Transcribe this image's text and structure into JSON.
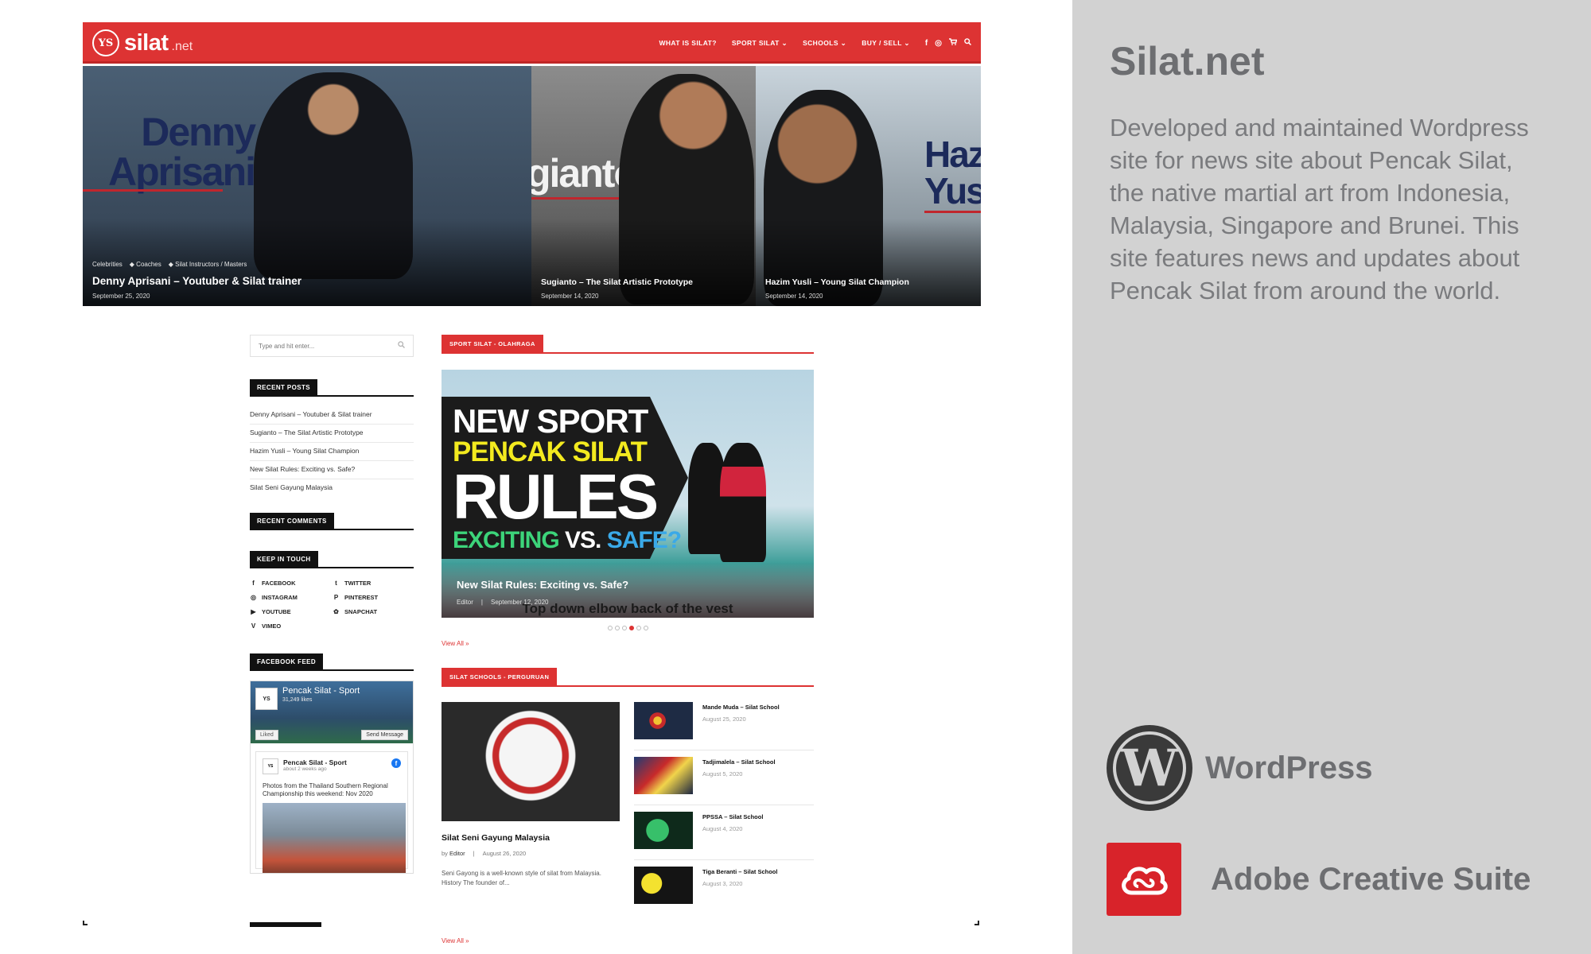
{
  "site": {
    "logo_text": "silat",
    "logo_tld": ".net",
    "logo_mark": "YS"
  },
  "nav": {
    "items": [
      "WHAT IS SILAT?",
      "SPORT SILAT ⌄",
      "SCHOOLS ⌄",
      "BUY / SELL ⌄"
    ],
    "icons": [
      "facebook-icon",
      "instagram-icon",
      "cart-icon",
      "search-icon"
    ]
  },
  "hero": {
    "slides": [
      {
        "big_name": "Denny\nAprisani",
        "categories": [
          "Celebrities",
          "◆ Coaches",
          "◆ Silat Instructors / Masters"
        ],
        "title": "Denny Aprisani – Youtuber & Silat trainer",
        "date": "September 25, 2020"
      },
      {
        "big_name": "gianto",
        "title": "Sugianto – The Silat Artistic Prototype",
        "date": "September 14, 2020"
      },
      {
        "big_name": "Hazi\nYusl",
        "title": "Hazim Yusli – Young Silat Champion",
        "date": "September 14, 2020"
      }
    ]
  },
  "sidebar": {
    "search_placeholder": "Type and hit enter...",
    "recent_posts_label": "RECENT POSTS",
    "recent_posts": [
      "Denny Aprisani – Youtuber & Silat trainer",
      "Sugianto – The Silat Artistic Prototype",
      "Hazim Yusli – Young Silat Champion",
      "New Silat Rules: Exciting vs. Safe?",
      "Silat Seni Gayung Malaysia"
    ],
    "recent_comments_label": "RECENT COMMENTS",
    "keep_in_touch_label": "KEEP IN TOUCH",
    "social": [
      {
        "glyph": "f",
        "label": "FACEBOOK",
        "icon": "facebook-icon"
      },
      {
        "glyph": "t",
        "label": "TWITTER",
        "icon": "twitter-icon"
      },
      {
        "glyph": "◎",
        "label": "INSTAGRAM",
        "icon": "instagram-icon"
      },
      {
        "glyph": "P",
        "label": "PINTEREST",
        "icon": "pinterest-icon"
      },
      {
        "glyph": "▶",
        "label": "YOUTUBE",
        "icon": "youtube-icon"
      },
      {
        "glyph": "✿",
        "label": "SNAPCHAT",
        "icon": "snapchat-icon"
      },
      {
        "glyph": "V",
        "label": "VIMEO",
        "icon": "vimeo-icon"
      }
    ],
    "facebook_feed_label": "FACEBOOK FEED",
    "fb": {
      "page_name": "Pencak Silat - Sport",
      "likes": "31,249 likes",
      "liked": "Liked",
      "send_message": "Send Message",
      "post_name": "Pencak Silat - Sport",
      "post_time": "about 2 weeks ago",
      "post_text": "Photos from the Thailand Southern Regional Championship this weekend: Nov 2020"
    }
  },
  "main": {
    "sport_label": "SPORT SILAT - OLAHRAGA",
    "feature": {
      "line1": "NEW SPORT",
      "line2": "PENCAK SILAT",
      "line3": "RULES",
      "line4a": "EXCITING",
      "line4b": "VS.",
      "line4c": "SAFE?",
      "caption": "Top down elbow back of the vest",
      "title": "New Silat Rules: Exciting vs. Safe?",
      "author": "Editor",
      "separator": "|",
      "date": "September 12, 2020"
    },
    "dots_count": 6,
    "active_dot": 4,
    "view_all": "View All »",
    "schools_label": "SILAT SCHOOLS - PERGURUAN",
    "lead": {
      "title": "Silat Seni Gayung Malaysia",
      "by": "by",
      "author": "Editor",
      "separator": "|",
      "date": "August 26, 2020",
      "excerpt": "Seni Gayong is a well-known style of silat from Malaysia. History The founder of..."
    },
    "schools": [
      {
        "title": "Mande Muda – Silat School",
        "date": "August 25, 2020"
      },
      {
        "title": "Tadjimalela – Silat School",
        "date": "August 5, 2020"
      },
      {
        "title": "PPSSA – Silat School",
        "date": "August 4, 2020"
      },
      {
        "title": "Tiga Beranti – Silat School",
        "date": "August 3, 2020"
      }
    ]
  },
  "panel": {
    "title": "Silat.net",
    "description": "Developed and maintained Wordpress site for news site about Pencak Silat, the native martial art from Indonesia, Malaysia, Singapore and Brunei. This site features news and updates about Pencak Silat from around the world.",
    "tools": [
      {
        "label": "WordPress",
        "icon": "wordpress-icon"
      },
      {
        "label": "Adobe Creative Suite",
        "icon": "adobe-creative-cloud-icon"
      }
    ]
  },
  "colors": {
    "brand_red": "#dd3333",
    "panel_gray": "#d2d2d2",
    "panel_text": "#6d6e71"
  }
}
